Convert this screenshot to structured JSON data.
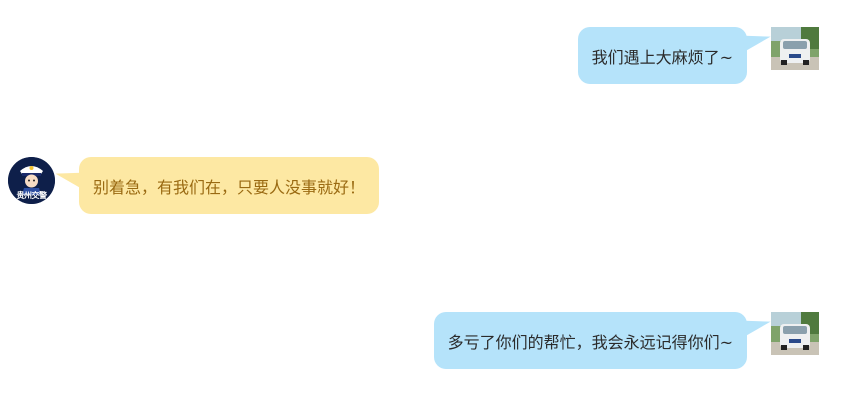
{
  "messages": [
    {
      "side": "right",
      "text": "我们遇上大麻烦了~",
      "avatar": "car-photo-avatar"
    },
    {
      "side": "left",
      "text": "别着急，有我们在，只要人没事就好！",
      "avatar": "traffic-police-avatar",
      "avatar_label": "贵州交警"
    },
    {
      "side": "right",
      "text": "多亏了你们的帮忙，我会永远记得你们~",
      "avatar": "car-photo-avatar"
    }
  ],
  "colors": {
    "blue_bubble": "#b5e3fa",
    "yellow_bubble": "#fde8a3",
    "yellow_text": "#9a6a12",
    "police_avatar_bg": "#0e1f4a"
  }
}
